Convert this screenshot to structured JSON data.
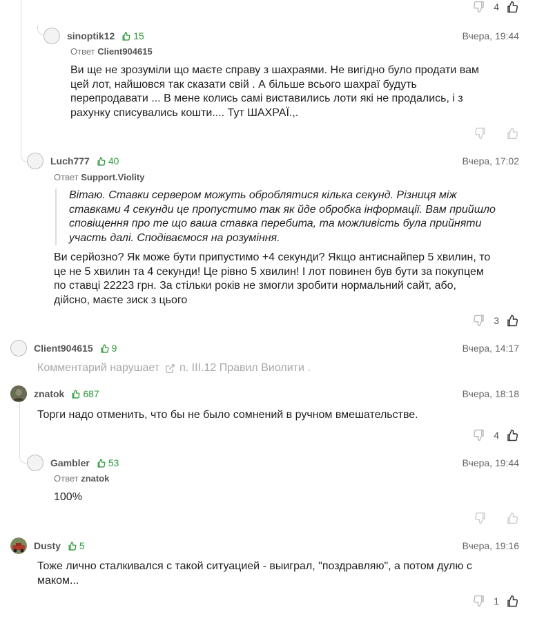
{
  "colors": {
    "rating": "#2e9a3e",
    "text": "#1f1f1f",
    "muted": "#a8a8a8",
    "thread": "#d9d9d9"
  },
  "top_actions": {
    "count": "4"
  },
  "comments": [
    {
      "username": "sinoptik12",
      "rating": "15",
      "date": "Вчера, 19:44",
      "reply_label": "Ответ",
      "reply_to": "Client904615",
      "lines": [
        "Ви ще не зрозуміли що маєте справу з шахраями. Не вигідно було продати вам",
        "цей лот, найшовся так сказати свій . А більше всього шахраї будуть",
        "перепродавати ... В мене колись самі виставились лоти які не продались, і з",
        "рахунку списувались кошти.... Тут ШАХРАЇ.,."
      ],
      "count": ""
    },
    {
      "username": "Luch777",
      "rating": "40",
      "date": "Вчера, 17:02",
      "reply_label": "Ответ",
      "reply_to": "Support.Violity",
      "quote_lines": [
        "Вітаю. Ставки сервером можуть оброблятися кілька секунд. Різниця між",
        "ставками 4 секунди це пропустимо так як йде обробка інформації. Вам прийшло",
        "сповіщення про те що ваша ставка перебита, та можливість була прийняти",
        "участь далі. Сподіваємося на розуміння."
      ],
      "lines": [
        "Ви серйозно? Як може бути припустимо +4 секунди? Якщо антиснайпер 5 хвилин, то",
        "це не 5 хвилин та 4 секунди! Це рівно 5 хвилин! І лот повинен був бути за покупцем",
        "по ставці 22223 грн. За стільки років не змогли зробити нормальний сайт, або,",
        "дійсно, маєте зиск з цього"
      ],
      "count": "3"
    },
    {
      "username": "Client904615",
      "rating": "9",
      "date": "Вчера, 14:17",
      "violation_text": "Комментарий нарушает",
      "violation_link": "п. III.12 Правил Виолити ."
    },
    {
      "username": "znatok",
      "rating": "687",
      "date": "Вчера, 18:18",
      "lines": [
        "Торги надо отменить, что бы не было сомнений в ручном вмешательстве."
      ],
      "count": "4"
    },
    {
      "username": "Gambler",
      "rating": "53",
      "date": "Вчера, 19:44",
      "reply_label": "Ответ",
      "reply_to": "znatok",
      "lines": [
        "100%"
      ],
      "count": ""
    },
    {
      "username": "Dusty",
      "rating": "5",
      "date": "Вчера, 19:16",
      "lines": [
        "Тоже лично сталкивался с такой ситуацией - выиграл, \"поздравляю\", а потом дулю с",
        "маком..."
      ],
      "count": "1"
    }
  ]
}
